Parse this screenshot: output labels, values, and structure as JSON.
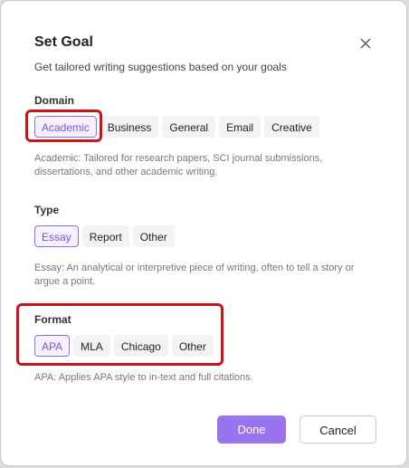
{
  "dialog": {
    "title": "Set Goal",
    "subtitle": "Get tailored writing suggestions based on your goals"
  },
  "domain": {
    "label": "Domain",
    "options": [
      "Academic",
      "Business",
      "General",
      "Email",
      "Creative"
    ],
    "selected": "Academic",
    "description": "Academic: Tailored for research papers, SCI journal submissions, dissertations, and other academic writing."
  },
  "type": {
    "label": "Type",
    "options": [
      "Essay",
      "Report",
      "Other"
    ],
    "selected": "Essay",
    "description": "Essay: An analytical or interpretive piece of writing, often to tell a story or argue a point."
  },
  "format": {
    "label": "Format",
    "options": [
      "APA",
      "MLA",
      "Chicago",
      "Other"
    ],
    "selected": "APA",
    "description": "APA: Applies APA style to in-text and full citations."
  },
  "actions": {
    "done_label": "Done",
    "cancel_label": "Cancel"
  },
  "colors": {
    "accent": "#9a73ef",
    "selected_border": "#8f6fe0",
    "annotation_red": "#c4161c"
  },
  "icons": {
    "close": "close-icon"
  }
}
